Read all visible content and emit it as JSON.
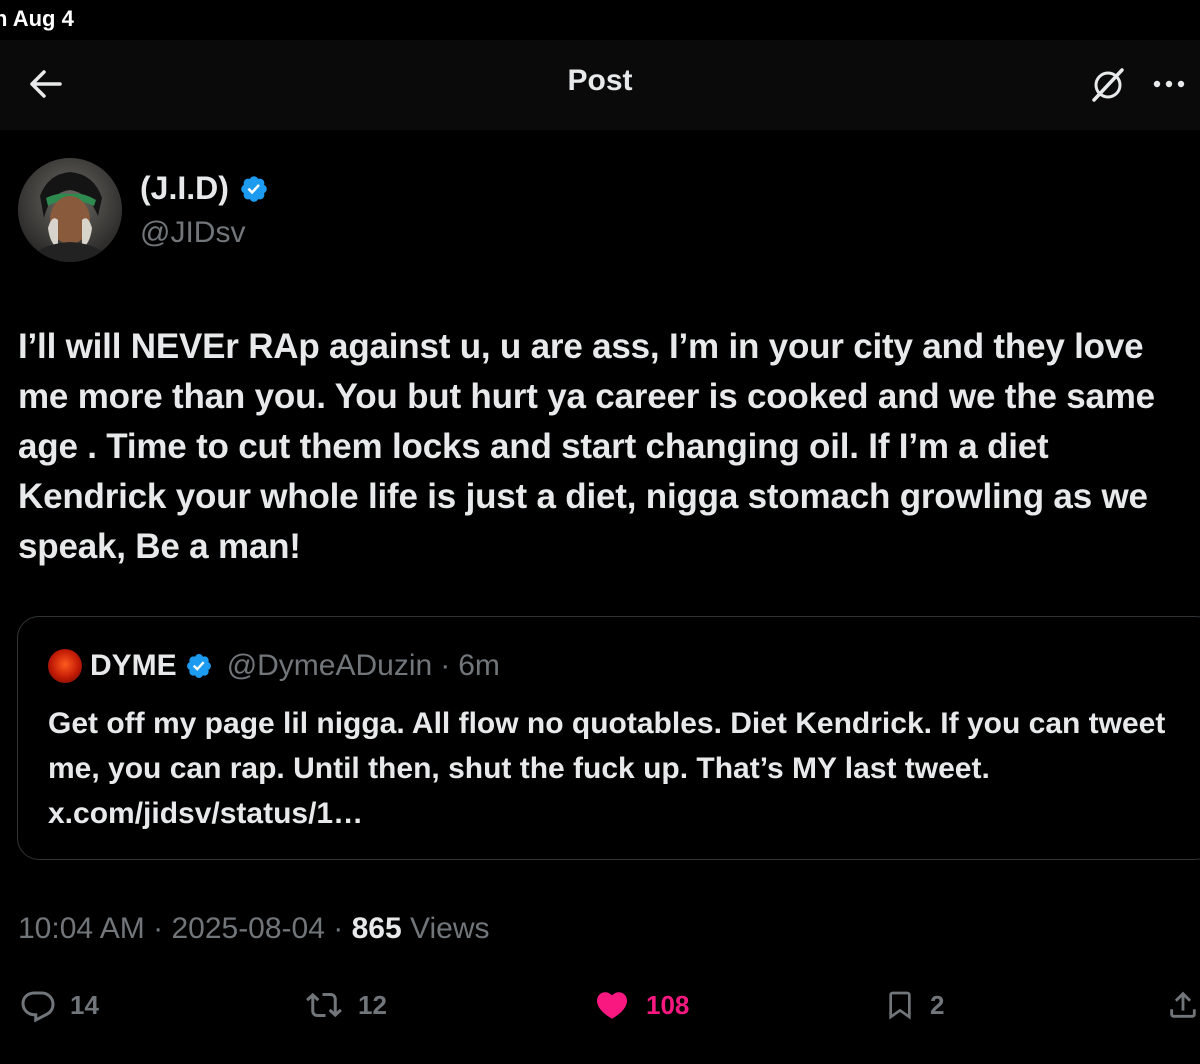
{
  "status_bar": {
    "time": "n Aug 4"
  },
  "nav": {
    "title": "Post"
  },
  "post": {
    "author_name": "(J.I.D)",
    "author_handle": "@JIDsv",
    "text": "I’ll will NEVEr RAp against u, u are ass, I’m in your city and they love me more than you. You but hurt ya career is cooked and we the same age . Time to cut them locks and start changing oil. If I’m a diet Kendrick your whole life is just a diet, nigga stomach growling as we speak, Be a man!",
    "time": "10:04 AM",
    "date": "2025-08-04",
    "separator": "·",
    "views_count": "865",
    "views_label": "Views"
  },
  "quote": {
    "name": "DYME",
    "handle": "@DymeADuzin",
    "separator": "·",
    "time": "6m",
    "text": "Get off my page lil nigga. All flow no quotables. Diet Kendrick. If you can tweet me, you can rap. Until then, shut the fuck up. That’s MY last tweet. x.com/jidsv/status/1…"
  },
  "actions": {
    "replies": "14",
    "reposts": "12",
    "likes": "108",
    "bookmarks": "2"
  },
  "colors": {
    "background": "#000000",
    "text": "#e7e9ea",
    "secondary": "#71767b",
    "verified": "#1d9bf0",
    "like": "#f91880"
  },
  "icons": [
    "back-arrow-icon",
    "grok-icon",
    "more-icon",
    "verified-badge-icon",
    "reply-icon",
    "repost-icon",
    "like-heart-icon",
    "bookmark-icon",
    "share-icon"
  ]
}
